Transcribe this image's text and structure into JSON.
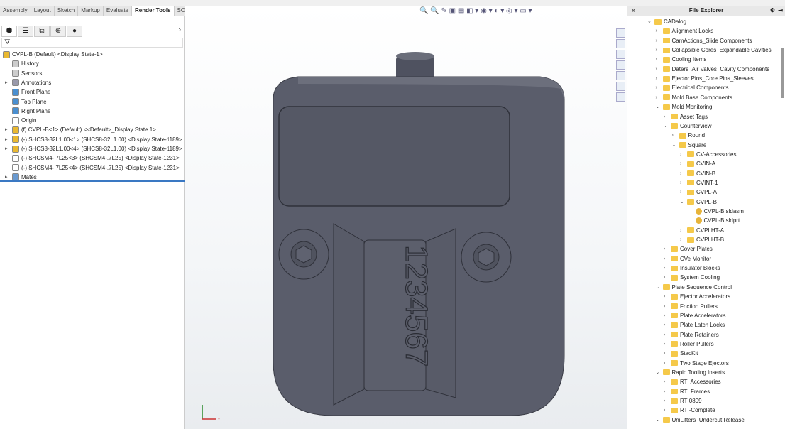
{
  "ribbon_tabs": [
    "Assembly",
    "Layout",
    "Sketch",
    "Markup",
    "Evaluate",
    "Render Tools",
    "SOLIDWORKS Add-Ins"
  ],
  "active_tab": "Render Tools",
  "feature_tree": [
    {
      "label": "CVPL-B (Default) <Display State-1>",
      "depth": 0,
      "icon": "assembly-icon",
      "expand": false
    },
    {
      "label": "History",
      "depth": 1,
      "icon": "history-icon",
      "expand": false
    },
    {
      "label": "Sensors",
      "depth": 1,
      "icon": "sensors-icon",
      "expand": false
    },
    {
      "label": "Annotations",
      "depth": 1,
      "icon": "annotations-icon",
      "expand": true
    },
    {
      "label": "Front Plane",
      "depth": 1,
      "icon": "plane-icon",
      "expand": false
    },
    {
      "label": "Top Plane",
      "depth": 1,
      "icon": "plane-icon",
      "expand": false
    },
    {
      "label": "Right Plane",
      "depth": 1,
      "icon": "plane-icon",
      "expand": false
    },
    {
      "label": "Origin",
      "depth": 1,
      "icon": "origin-icon",
      "expand": false
    },
    {
      "label": "(f) CVPL-B<1> (Default) <<Default>_Display State 1>",
      "depth": 1,
      "icon": "part-icon",
      "expand": true
    },
    {
      "label": "(-) SHCS8-32L1.00<1> (SHCS8-32L1.00) <Display State-1189>",
      "depth": 1,
      "icon": "part-icon",
      "expand": true
    },
    {
      "label": "(-) SHCS8-32L1.00<4> (SHCS8-32L1.00) <Display State-1189>",
      "depth": 1,
      "icon": "part-icon",
      "expand": true
    },
    {
      "label": "(-) SHCSM4-.7L25<3> (SHCSM4-.7L25) <Display State-1231>",
      "depth": 1,
      "icon": "part-outline-icon",
      "expand": false
    },
    {
      "label": "(-) SHCSM4-.7L25<4> (SHCSM4-.7L25) <Display State-1231>",
      "depth": 1,
      "icon": "part-outline-icon",
      "expand": false
    },
    {
      "label": "Mates",
      "depth": 1,
      "icon": "mates-icon",
      "expand": true
    }
  ],
  "file_explorer": {
    "title": "File Explorer",
    "items": [
      {
        "label": "CADalog",
        "depth": 0,
        "type": "folder",
        "state": "open"
      },
      {
        "label": "Alignment Locks",
        "depth": 1,
        "type": "folder",
        "state": "closed"
      },
      {
        "label": "CamActions_Slide Components",
        "depth": 1,
        "type": "folder",
        "state": "closed"
      },
      {
        "label": "Collapsible Cores_Expandable Cavities",
        "depth": 1,
        "type": "folder",
        "state": "closed"
      },
      {
        "label": "Cooling Items",
        "depth": 1,
        "type": "folder",
        "state": "closed"
      },
      {
        "label": "Daters_Air Valves_Cavity Components",
        "depth": 1,
        "type": "folder",
        "state": "closed"
      },
      {
        "label": "Ejector Pins_Core Pins_Sleeves",
        "depth": 1,
        "type": "folder",
        "state": "closed"
      },
      {
        "label": "Electrical Components",
        "depth": 1,
        "type": "folder",
        "state": "closed"
      },
      {
        "label": "Mold Base Components",
        "depth": 1,
        "type": "folder",
        "state": "closed"
      },
      {
        "label": "Mold Monitoring",
        "depth": 1,
        "type": "folder",
        "state": "open"
      },
      {
        "label": "Asset Tags",
        "depth": 2,
        "type": "folder",
        "state": "closed"
      },
      {
        "label": "Counterview",
        "depth": 2,
        "type": "folder",
        "state": "open"
      },
      {
        "label": "Round",
        "depth": 3,
        "type": "folder",
        "state": "closed"
      },
      {
        "label": "Square",
        "depth": 3,
        "type": "folder",
        "state": "open"
      },
      {
        "label": "CV-Accessories",
        "depth": 4,
        "type": "folder",
        "state": "closed"
      },
      {
        "label": "CVIN-A",
        "depth": 4,
        "type": "folder",
        "state": "closed"
      },
      {
        "label": "CVIN-B",
        "depth": 4,
        "type": "folder",
        "state": "closed"
      },
      {
        "label": "CVINT-1",
        "depth": 4,
        "type": "folder",
        "state": "closed"
      },
      {
        "label": "CVPL-A",
        "depth": 4,
        "type": "folder",
        "state": "closed"
      },
      {
        "label": "CVPL-B",
        "depth": 4,
        "type": "folder",
        "state": "open"
      },
      {
        "label": "CVPL-B.sldasm",
        "depth": 5,
        "type": "file",
        "state": ""
      },
      {
        "label": "CVPL-B.sldprt",
        "depth": 5,
        "type": "file",
        "state": ""
      },
      {
        "label": "CVPLHT-A",
        "depth": 4,
        "type": "folder",
        "state": "closed"
      },
      {
        "label": "CVPLHT-B",
        "depth": 4,
        "type": "folder",
        "state": "closed"
      },
      {
        "label": "Cover Plates",
        "depth": 2,
        "type": "folder",
        "state": "closed"
      },
      {
        "label": "CVe Monitor",
        "depth": 2,
        "type": "folder",
        "state": "closed"
      },
      {
        "label": "Insulator Blocks",
        "depth": 2,
        "type": "folder",
        "state": "closed"
      },
      {
        "label": "System Cooling",
        "depth": 2,
        "type": "folder",
        "state": "closed"
      },
      {
        "label": "Plate Sequence Control",
        "depth": 1,
        "type": "folder",
        "state": "open"
      },
      {
        "label": "Ejector Accelerators",
        "depth": 2,
        "type": "folder",
        "state": "closed"
      },
      {
        "label": "Friction Pullers",
        "depth": 2,
        "type": "folder",
        "state": "closed"
      },
      {
        "label": "Plate Accelerators",
        "depth": 2,
        "type": "folder",
        "state": "closed"
      },
      {
        "label": "Plate Latch Locks",
        "depth": 2,
        "type": "folder",
        "state": "closed"
      },
      {
        "label": "Plate Retainers",
        "depth": 2,
        "type": "folder",
        "state": "closed"
      },
      {
        "label": "Roller Pullers",
        "depth": 2,
        "type": "folder",
        "state": "closed"
      },
      {
        "label": "StacKit",
        "depth": 2,
        "type": "folder",
        "state": "closed"
      },
      {
        "label": "Two Stage Ejectors",
        "depth": 2,
        "type": "folder",
        "state": "closed"
      },
      {
        "label": "Rapid Tooling Inserts",
        "depth": 1,
        "type": "folder",
        "state": "open"
      },
      {
        "label": "RTI Accessories",
        "depth": 2,
        "type": "folder",
        "state": "closed"
      },
      {
        "label": "RTI Frames",
        "depth": 2,
        "type": "folder",
        "state": "closed"
      },
      {
        "label": "RTI0809",
        "depth": 2,
        "type": "folder",
        "state": "closed"
      },
      {
        "label": "RTI-Complete",
        "depth": 2,
        "type": "folder",
        "state": "closed"
      },
      {
        "label": "UniLifters_Undercut Release",
        "depth": 1,
        "type": "folder",
        "state": "open"
      }
    ]
  },
  "model": {
    "counter_digits": "1234567",
    "body_color": "#5a5d6b"
  }
}
